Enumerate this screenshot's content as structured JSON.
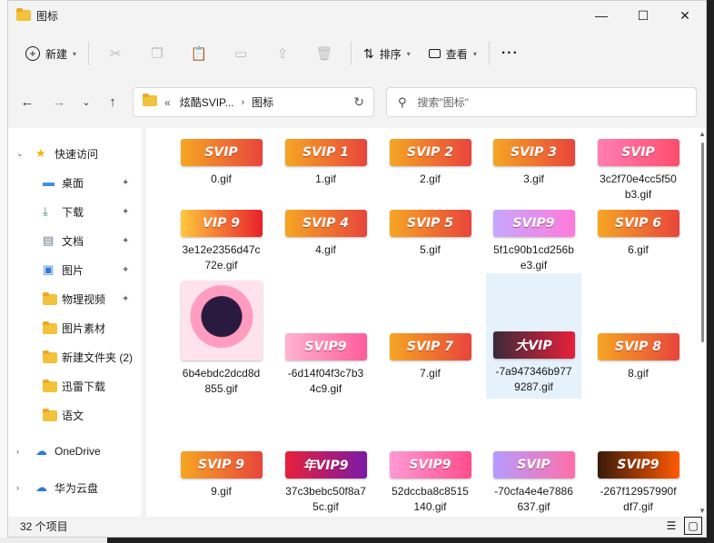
{
  "window": {
    "title": "图标",
    "controls": {
      "minimize": "—",
      "maximize": "☐",
      "close": "✕"
    }
  },
  "toolbar": {
    "new_label": "新建",
    "sort_label": "排序",
    "view_label": "查看",
    "more_label": "···",
    "icons": [
      "cut-icon",
      "copy-icon",
      "paste-icon",
      "rename-icon",
      "share-icon",
      "delete-icon"
    ]
  },
  "nav": {
    "back": "←",
    "forward": "→",
    "recent": "⌄",
    "up": "↑",
    "address": {
      "overflow": "«",
      "parent": "炫酷SVIP...",
      "separator": "›",
      "current": "图标"
    },
    "refresh": "↻",
    "search_placeholder": "搜索\"图标\""
  },
  "sidebar": {
    "items": [
      {
        "label": "快速访问",
        "icon": "star-icon",
        "expand": "⌄",
        "pinned": false
      },
      {
        "label": "桌面",
        "icon": "desktop-icon",
        "pinned": true
      },
      {
        "label": "下载",
        "icon": "download-icon",
        "pinned": true
      },
      {
        "label": "文档",
        "icon": "document-icon",
        "pinned": true
      },
      {
        "label": "图片",
        "icon": "picture-icon",
        "pinned": true
      },
      {
        "label": "物理视频",
        "icon": "folder-icon",
        "pinned": true
      },
      {
        "label": "图片素材",
        "icon": "folder-icon",
        "pinned": false
      },
      {
        "label": "新建文件夹 (2)",
        "icon": "folder-icon",
        "pinned": false
      },
      {
        "label": "迅雷下载",
        "icon": "folder-icon",
        "pinned": false
      },
      {
        "label": "语文",
        "icon": "folder-icon",
        "pinned": false
      },
      {
        "label": "OneDrive",
        "icon": "cloud-icon",
        "expand": "›",
        "pinned": false
      },
      {
        "label": "华为云盘",
        "icon": "cloud-icon",
        "expand": "›",
        "pinned": false
      }
    ],
    "pin_glyph": "📌"
  },
  "files": [
    {
      "name": "0.gif",
      "badge": "SVIP",
      "colors": [
        "#f5a623",
        "#e8453c"
      ]
    },
    {
      "name": "1.gif",
      "badge": "SVIP 1",
      "colors": [
        "#f5a623",
        "#e8453c"
      ]
    },
    {
      "name": "2.gif",
      "badge": "SVIP 2",
      "colors": [
        "#f5a623",
        "#e8453c"
      ]
    },
    {
      "name": "3.gif",
      "badge": "SVIP 3",
      "colors": [
        "#f5a623",
        "#e8453c"
      ]
    },
    {
      "name": "3c2f70e4cc5f50b3.gif",
      "badge": "SVIP",
      "colors": [
        "#ff7eb3",
        "#ff4d6d"
      ]
    },
    {
      "name": "3e12e2356d47c72e.gif",
      "badge": "VIP 9",
      "colors": [
        "#ffc83d",
        "#e8202a"
      ]
    },
    {
      "name": "4.gif",
      "badge": "SVIP 4",
      "colors": [
        "#f5a623",
        "#e8453c"
      ]
    },
    {
      "name": "5.gif",
      "badge": "SVIP 5",
      "colors": [
        "#f5a623",
        "#e8453c"
      ]
    },
    {
      "name": "5f1c90b1cd256be3.gif",
      "badge": "SVIP9",
      "colors": [
        "#c7a7ff",
        "#ff7ad9"
      ]
    },
    {
      "name": "6.gif",
      "badge": "SVIP 6",
      "colors": [
        "#f5a623",
        "#e8453c"
      ]
    },
    {
      "name": "6b4ebdc2dcd8d855.gif",
      "badge": "",
      "colors": [
        "#ffd6e0",
        "#7a2a8a"
      ]
    },
    {
      "name": "-6d14f04f3c7b34c9.gif",
      "badge": "SVIP9",
      "colors": [
        "#ffb3d1",
        "#ff5c9a"
      ]
    },
    {
      "name": "7.gif",
      "badge": "SVIP 7",
      "colors": [
        "#f5a623",
        "#e8453c"
      ]
    },
    {
      "name": "-7a947346b9779287.gif",
      "badge": "大VIP",
      "colors": [
        "#3a2a3a",
        "#e8203a"
      ]
    },
    {
      "name": "8.gif",
      "badge": "SVIP 8",
      "colors": [
        "#f5a623",
        "#e8453c"
      ]
    },
    {
      "name": "9.gif",
      "badge": "SVIP 9",
      "colors": [
        "#f5a623",
        "#e8453c"
      ]
    },
    {
      "name": "37c3bebc50f8a75c.gif",
      "badge": "年VIP9",
      "colors": [
        "#e8203a",
        "#7a1aa8"
      ]
    },
    {
      "name": "52dccba8c8515140.gif",
      "badge": "SVIP9",
      "colors": [
        "#ff9ad5",
        "#ff4d8d"
      ]
    },
    {
      "name": "-70cfa4e4e7886637.gif",
      "badge": "SVIP",
      "colors": [
        "#b59cff",
        "#ff6fa8"
      ]
    },
    {
      "name": "-267f12957990fdf7.gif",
      "badge": "SVIP9",
      "colors": [
        "#3a1a0a",
        "#ff5a00"
      ]
    }
  ],
  "status": {
    "count": "32 个项目",
    "details_view": "☰",
    "tiles_view": "▢"
  }
}
